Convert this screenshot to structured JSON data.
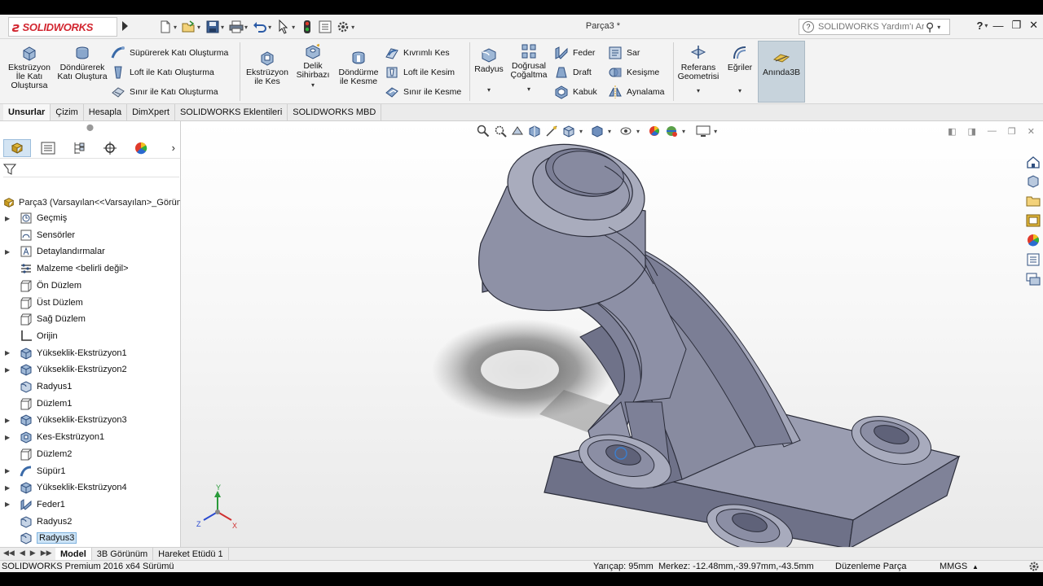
{
  "titlebar": {
    "app_name": "SOLIDWORKS",
    "document_title": "Parça3 *",
    "help_search_placeholder": "SOLIDWORKS Yardım'ı Ara",
    "help_label": "?"
  },
  "ribbon": {
    "extruded_boss": "Ekstrüzyon İle Katı Oluştursa",
    "revolved_boss": "Döndürerek Katı Oluştura",
    "swept_boss": "Süpürerek Katı Oluşturma",
    "lofted_boss": "Loft ile Katı Oluşturma",
    "boundary_boss": "Sınır ile Katı Oluşturma",
    "extruded_cut": "Ekstrüzyon ile Kes",
    "hole_wizard": "Delik Sihirbazı",
    "revolved_cut": "Döndürme ile Kesme",
    "swept_cut": "Kıvrımlı Kes",
    "lofted_cut": "Loft ile Kesim",
    "boundary_cut": "Sınır ile Kesme",
    "fillet": "Radyus",
    "linear_pattern": "Doğrusal Çoğaltma",
    "rib": "Feder",
    "draft": "Draft",
    "shell": "Kabuk",
    "wrap": "Sar",
    "intersect": "Kesişme",
    "mirror": "Aynalama",
    "reference_geometry": "Referans Geometrisi",
    "curves": "Eğriler",
    "instant3d": "Anında3B"
  },
  "tabs": [
    "Unsurlar",
    "Çizim",
    "Hesapla",
    "DimXpert",
    "SOLIDWORKS Eklentileri",
    "SOLIDWORKS MBD"
  ],
  "tree": {
    "root": "Parça3  (Varsayılan<<Varsayılan>_Görün",
    "items": [
      {
        "label": "Geçmiş",
        "icon": "history-icon",
        "expandable": true
      },
      {
        "label": "Sensörler",
        "icon": "sensor-icon",
        "expandable": false
      },
      {
        "label": "Detaylandırmalar",
        "icon": "annotation-icon",
        "expandable": true
      },
      {
        "label": "Malzeme <belirli değil>",
        "icon": "material-icon",
        "expandable": false
      },
      {
        "label": "Ön Düzlem",
        "icon": "plane-icon",
        "expandable": false
      },
      {
        "label": "Üst Düzlem",
        "icon": "plane-icon",
        "expandable": false
      },
      {
        "label": "Sağ Düzlem",
        "icon": "plane-icon",
        "expandable": false
      },
      {
        "label": "Orijin",
        "icon": "origin-icon",
        "expandable": false
      },
      {
        "label": "Yükseklik-Ekstrüzyon1",
        "icon": "extrude-icon",
        "expandable": true
      },
      {
        "label": "Yükseklik-Ekstrüzyon2",
        "icon": "extrude-icon",
        "expandable": true
      },
      {
        "label": "Radyus1",
        "icon": "fillet-icon",
        "expandable": false
      },
      {
        "label": "Düzlem1",
        "icon": "plane-icon",
        "expandable": false
      },
      {
        "label": "Yükseklik-Ekstrüzyon3",
        "icon": "extrude-icon",
        "expandable": true
      },
      {
        "label": "Kes-Ekstrüzyon1",
        "icon": "cut-icon",
        "expandable": true
      },
      {
        "label": "Düzlem2",
        "icon": "plane-icon",
        "expandable": false
      },
      {
        "label": "Süpür1",
        "icon": "sweep-icon",
        "expandable": true
      },
      {
        "label": "Yükseklik-Ekstrüzyon4",
        "icon": "extrude-icon",
        "expandable": true
      },
      {
        "label": "Feder1",
        "icon": "rib-icon",
        "expandable": true
      },
      {
        "label": "Radyus2",
        "icon": "fillet-icon",
        "expandable": false
      },
      {
        "label": "Radyus3",
        "icon": "fillet-icon",
        "expandable": false,
        "selected": true
      }
    ]
  },
  "bottom_tabs": [
    "Model",
    "3B Görünüm",
    "Hareket Etüdü 1"
  ],
  "statusbar": {
    "version": "SOLIDWORKS Premium 2016 x64 Sürümü",
    "radius": "Yarıçap: 95mm",
    "center": "Merkez: -12.48mm,-39.97mm,-43.5mm",
    "mode": "Düzenleme Parça",
    "units": "MMGS"
  },
  "triad": {
    "x": "X",
    "y": "Y",
    "z": "Z"
  },
  "colors": {
    "brand_red": "#d22630",
    "model_gray": "#8f92a6",
    "selection_blue": "#cde4f7",
    "instant3d_bg": "#c7d3dc"
  }
}
